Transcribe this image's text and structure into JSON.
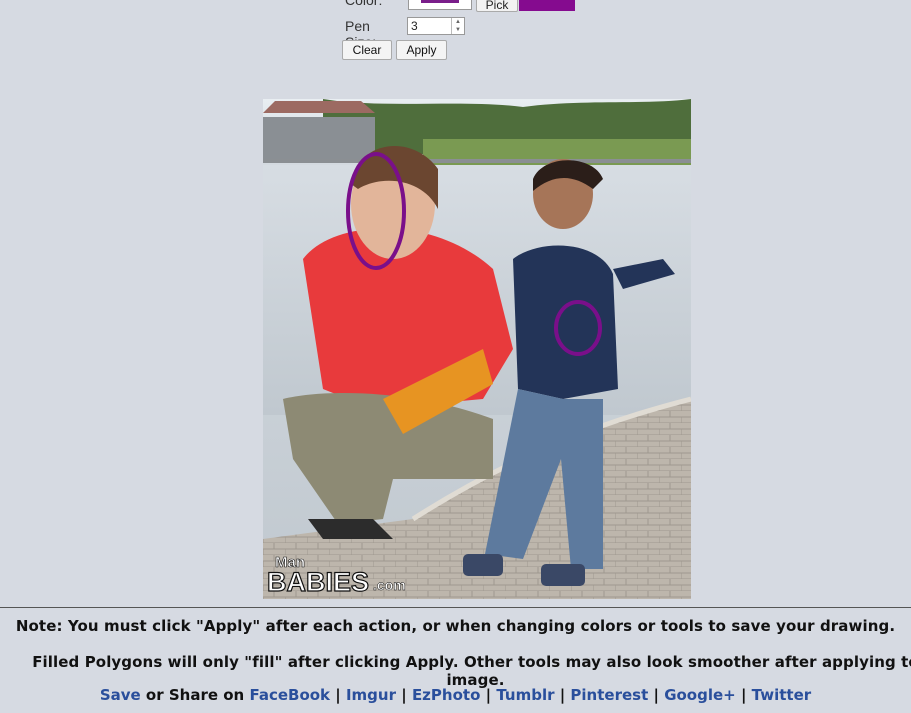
{
  "controls": {
    "color_label": "Color:",
    "pick_label": "Pick",
    "pen_label": "Pen Size:",
    "pen_value": "3",
    "clear_label": "Clear",
    "apply_label": "Apply",
    "selected_color": "#850b8f"
  },
  "image": {
    "logo_top": "Man",
    "logo_main": "BABIES",
    "logo_suffix": ".com"
  },
  "notes": {
    "line1": "Note: You must click \"Apply\" after each action, or when changing colors or tools to save your drawing.",
    "line2": "Filled Polygons will only \"fill\" after clicking Apply. Other tools may also look smoother after applying to image."
  },
  "share": {
    "save": "Save",
    "or_share_on": " or Share on ",
    "links": [
      "FaceBook",
      "Imgur",
      "EzPhoto",
      "Tumblr",
      "Pinterest",
      "Google+",
      "Twitter"
    ],
    "separator": " | "
  }
}
